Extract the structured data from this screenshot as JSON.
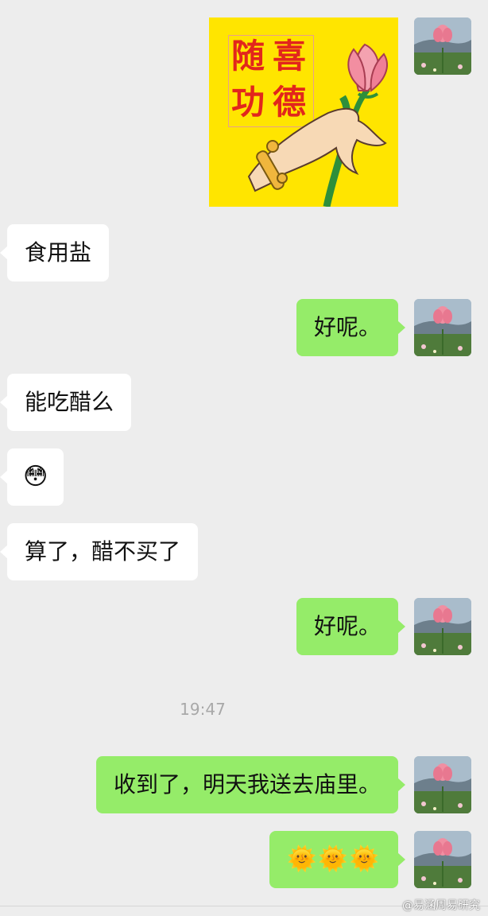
{
  "messages": [
    {
      "id": "m1",
      "side": "out",
      "kind": "sticker",
      "sticker_text": [
        "随",
        "喜",
        "功",
        "德"
      ]
    },
    {
      "id": "m2",
      "side": "in",
      "kind": "text",
      "text": "食用盐"
    },
    {
      "id": "m3",
      "side": "out",
      "kind": "text",
      "text": "好呢。"
    },
    {
      "id": "m4",
      "side": "in",
      "kind": "text",
      "text": "能吃醋么"
    },
    {
      "id": "m5",
      "side": "in",
      "kind": "emoji",
      "text": "😳"
    },
    {
      "id": "m6",
      "side": "in",
      "kind": "text",
      "text": "算了，醋不买了"
    },
    {
      "id": "m7",
      "side": "out",
      "kind": "text",
      "text": "好呢。"
    },
    {
      "id": "m8",
      "side": "out",
      "kind": "text",
      "text": "收到了，明天我送去庙里。"
    },
    {
      "id": "m9",
      "side": "out",
      "kind": "emoji",
      "text": "🌞🌞🌞"
    }
  ],
  "timestamp": "19:47",
  "watermark": "@易涵周易研究",
  "colors": {
    "background": "#ededed",
    "incoming_bubble": "#ffffff",
    "outgoing_bubble": "#95ec69",
    "sticker_bg": "#ffe500",
    "sticker_text": "#e2261c"
  },
  "icons": {
    "avatar": "lotus-avatar-icon",
    "sticker": "lotus-hand-sticker-icon"
  }
}
